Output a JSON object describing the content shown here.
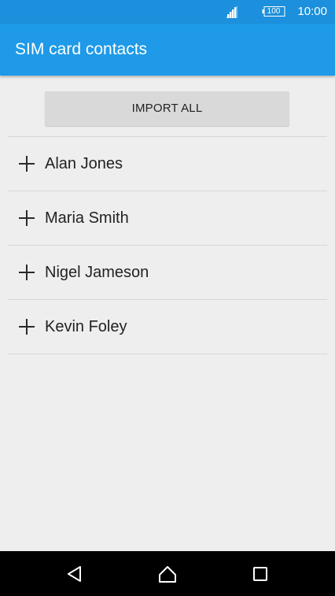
{
  "status_bar": {
    "battery": "100",
    "time": "10:00",
    "icons": [
      "signal-icon",
      "battery-icon"
    ]
  },
  "app_bar": {
    "title": "SIM card contacts"
  },
  "import_button": {
    "label": "IMPORT ALL"
  },
  "contacts": [
    {
      "name": "Alan Jones",
      "icon": "plus-icon"
    },
    {
      "name": "Maria Smith",
      "icon": "plus-icon"
    },
    {
      "name": "Nigel Jameson",
      "icon": "plus-icon"
    },
    {
      "name": "Kevin Foley",
      "icon": "plus-icon"
    }
  ],
  "nav_bar": {
    "icons": [
      "back-icon",
      "home-icon",
      "recents-icon"
    ]
  },
  "colors": {
    "status_bar": "#1c90dc",
    "app_bar": "#1e9ae8",
    "background": "#eeeeee",
    "button": "#d9d9d9"
  }
}
